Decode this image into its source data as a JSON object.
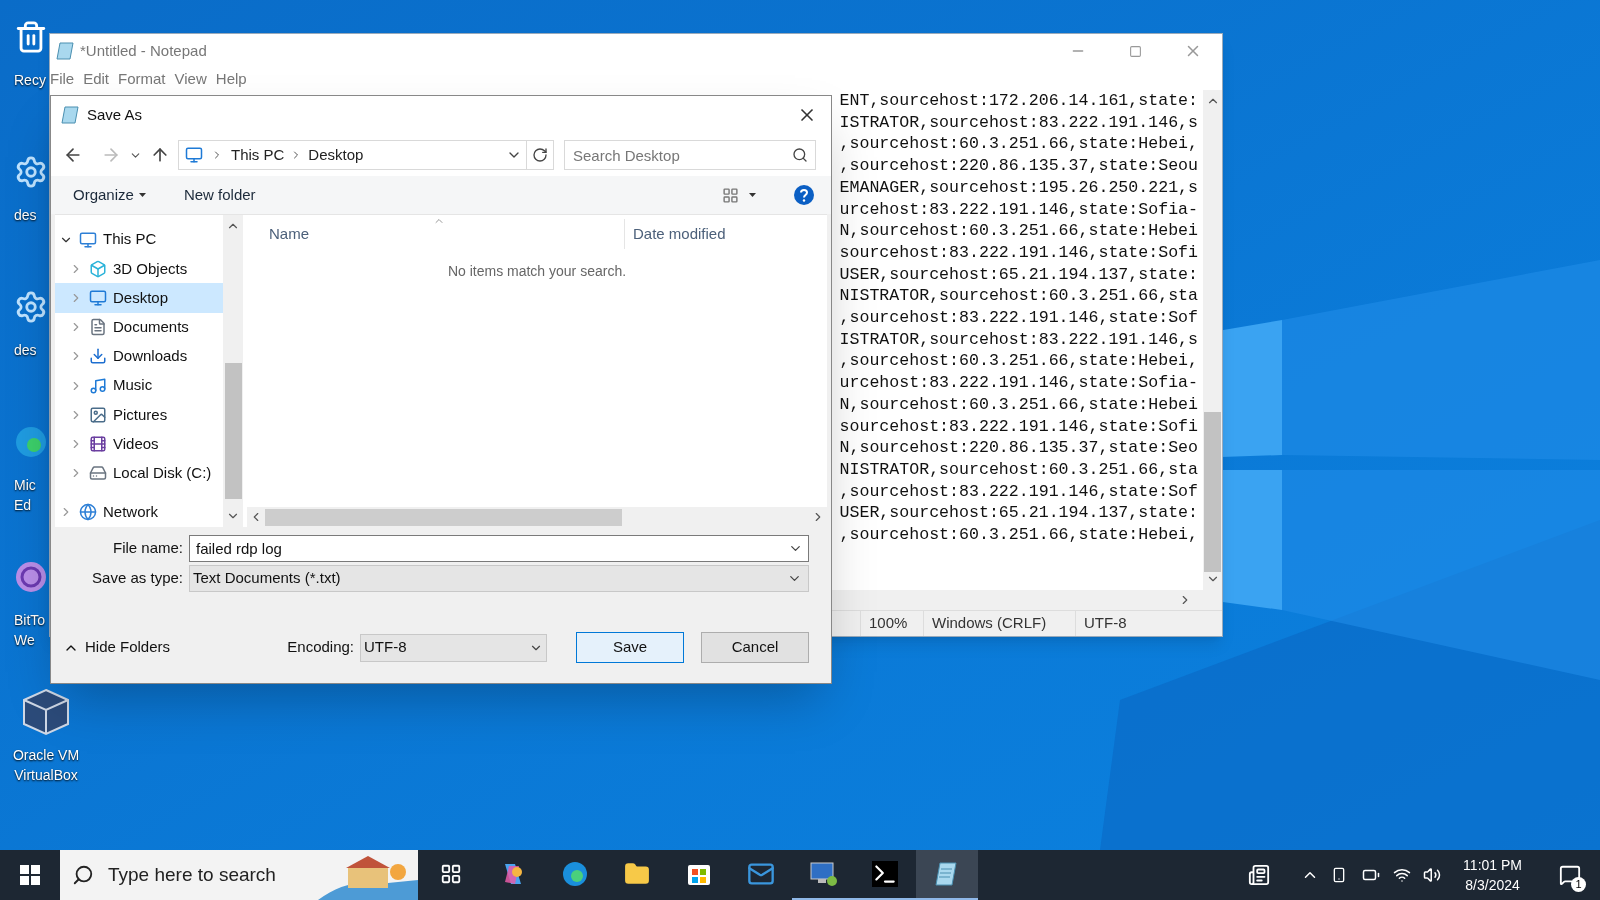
{
  "desktop_icons": [
    {
      "kind": "recycle",
      "lines": [
        "Recy"
      ]
    },
    {
      "kind": "settings",
      "lines": [
        "des"
      ]
    },
    {
      "kind": "settings",
      "lines": [
        "des"
      ]
    },
    {
      "kind": "edge",
      "lines": [
        "Mic",
        "Ed"
      ]
    },
    {
      "kind": "torrent",
      "lines": [
        "BitTo",
        "We"
      ]
    },
    {
      "kind": "virtualbox",
      "lines": [
        "Oracle VM",
        "VirtualBox"
      ]
    }
  ],
  "notepad": {
    "title": "*Untitled - Notepad",
    "menu": [
      "File",
      "Edit",
      "Format",
      "View",
      "Help"
    ],
    "lines": [
      "ENT,sourcehost:172.206.14.161,state:",
      "ISTRATOR,sourcehost:83.222.191.146,s",
      ",sourcehost:60.3.251.66,state:Hebei,",
      ",sourcehost:220.86.135.37,state:Seou",
      "EMANAGER,sourcehost:195.26.250.221,s",
      "urcehost:83.222.191.146,state:Sofia-",
      "N,sourcehost:60.3.251.66,state:Hebei",
      "sourcehost:83.222.191.146,state:Sofi",
      "USER,sourcehost:65.21.194.137,state:",
      "NISTRATOR,sourcehost:60.3.251.66,sta",
      ",sourcehost:83.222.191.146,state:Sof",
      "ISTRATOR,sourcehost:83.222.191.146,s",
      ",sourcehost:60.3.251.66,state:Hebei,",
      "urcehost:83.222.191.146,state:Sofia-",
      "N,sourcehost:60.3.251.66,state:Hebei",
      "sourcehost:83.222.191.146,state:Sofi",
      "N,sourcehost:220.86.135.37,state:Seo",
      "NISTRATOR,sourcehost:60.3.251.66,sta",
      ",sourcehost:83.222.191.146,state:Sof",
      "USER,sourcehost:65.21.194.137,state:",
      ",sourcehost:60.3.251.66,state:Hebei,"
    ],
    "status": [
      "100%",
      "Windows (CRLF)",
      "UTF-8"
    ]
  },
  "dialog": {
    "title": "Save As",
    "breadcrumb": [
      "This PC",
      "Desktop"
    ],
    "search_placeholder": "Search Desktop",
    "toolbar": [
      "Organize",
      "New folder"
    ],
    "tree": [
      {
        "kind": "pc",
        "label": "This PC",
        "expanded": true,
        "selected": false,
        "children": [
          {
            "kind": "cube",
            "label": "3D Objects",
            "expanded": false,
            "selected": false
          },
          {
            "kind": "desktop",
            "label": "Desktop",
            "expanded": false,
            "selected": true
          },
          {
            "kind": "documents",
            "label": "Documents",
            "expanded": false,
            "selected": false
          },
          {
            "kind": "downloads",
            "label": "Downloads",
            "expanded": false,
            "selected": false
          },
          {
            "kind": "music",
            "label": "Music",
            "expanded": false,
            "selected": false
          },
          {
            "kind": "pictures",
            "label": "Pictures",
            "expanded": false,
            "selected": false
          },
          {
            "kind": "videos",
            "label": "Videos",
            "expanded": false,
            "selected": false
          },
          {
            "kind": "disk",
            "label": "Local Disk (C:)",
            "expanded": false,
            "selected": false
          }
        ]
      },
      {
        "kind": "network",
        "label": "Network",
        "expanded": false,
        "selected": false
      }
    ],
    "columns": [
      "Name",
      "Date modified"
    ],
    "empty_message": "No items match your search.",
    "file_name_label": "File name:",
    "file_name": "failed rdp log",
    "type_label": "Save as type:",
    "type_value": "Text Documents (*.txt)",
    "hide_folders": "Hide Folders",
    "encoding_label": "Encoding:",
    "encoding": "UTF-8",
    "buttons": [
      "Save",
      "Cancel"
    ]
  },
  "taskbar": {
    "search_placeholder": "Type here to search",
    "apps": [
      {
        "kind": "taskview",
        "running": false,
        "active": false
      },
      {
        "kind": "copilot",
        "running": false,
        "active": false
      },
      {
        "kind": "edge",
        "running": false,
        "active": false
      },
      {
        "kind": "explorer",
        "running": false,
        "active": false
      },
      {
        "kind": "store",
        "running": false,
        "active": false
      },
      {
        "kind": "mail",
        "running": false,
        "active": false
      },
      {
        "kind": "remote",
        "running": true,
        "active": false
      },
      {
        "kind": "terminal",
        "running": true,
        "active": false
      },
      {
        "kind": "notepad",
        "running": true,
        "active": true
      }
    ],
    "time": "11:01 PM",
    "date": "8/3/2024",
    "notifications": "1"
  }
}
